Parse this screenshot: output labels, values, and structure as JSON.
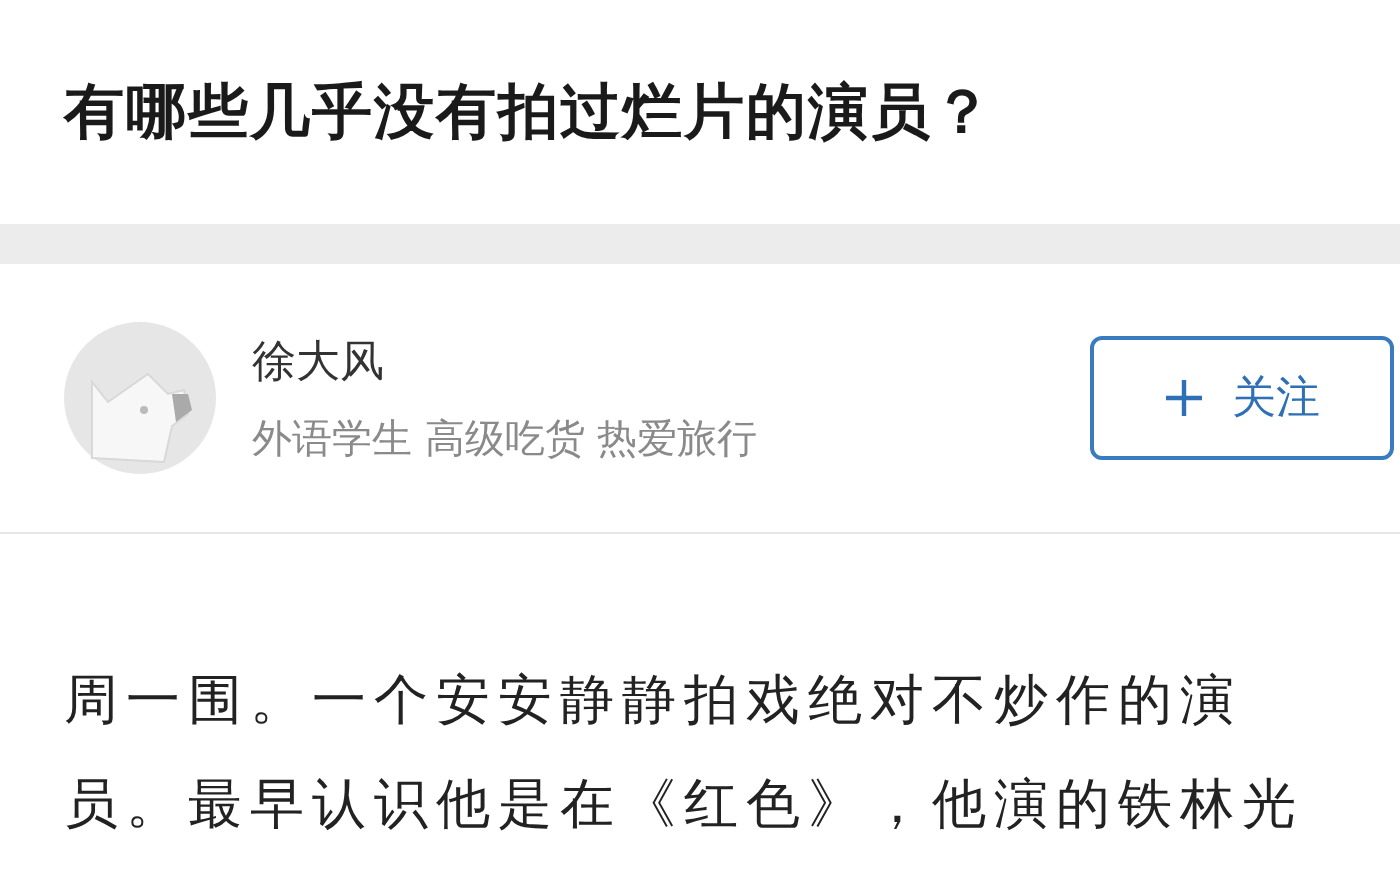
{
  "question": {
    "title": "有哪些几乎没有拍过烂片的演员？"
  },
  "author": {
    "name": "徐大风",
    "bio": "外语学生 高级吃货 热爱旅行",
    "follow_label": "关注",
    "following": false
  },
  "answer": {
    "text": "周一围。一个安安静静拍戏绝对不炒作的演员。最早认识他是在《红色》，他演的铁林光"
  }
}
